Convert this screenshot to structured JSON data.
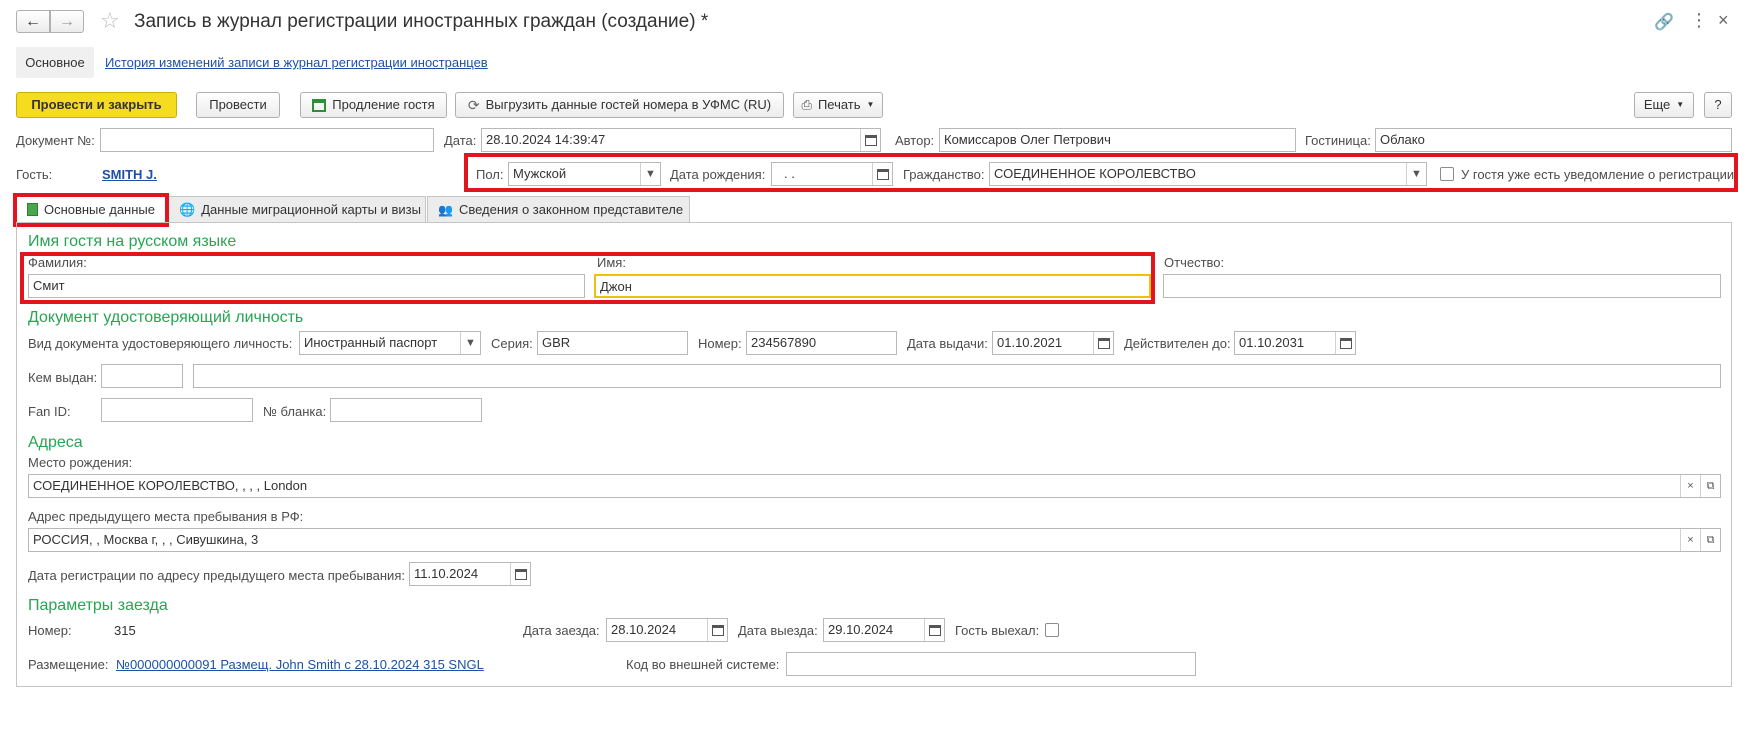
{
  "window": {
    "title": "Запись в журнал регистрации иностранных граждан (создание) *"
  },
  "nav_tabs": {
    "main": "Основное",
    "history": "История изменений записи в журнал регистрации иностранцев"
  },
  "toolbar": {
    "post_close": "Провести и закрыть",
    "post": "Провести",
    "extend_guest": "Продление гостя",
    "export_ufms": "Выгрузить данные гостей номера в УФМС (RU)",
    "print": "Печать",
    "more": "Еще",
    "help": "?"
  },
  "header": {
    "doc_no_label": "Документ №:",
    "doc_no_value": "",
    "date_label": "Дата:",
    "date_value": "28.10.2024 14:39:47",
    "author_label": "Автор:",
    "author_value": "Комиссаров Олег Петрович",
    "hotel_label": "Гостиница:",
    "hotel_value": "Облако",
    "guest_label": "Гость:",
    "guest_value": "SMITH J.",
    "sex_label": "Пол:",
    "sex_value": "Мужской",
    "birth_label": "Дата рождения:",
    "birth_value": ".  .",
    "citizenship_label": "Гражданство:",
    "citizenship_value": "СОЕДИНЕННОЕ КОРОЛЕВСТВО",
    "notice_label": "У гостя уже есть уведомление о регистрации",
    "notice_checked": false
  },
  "tabs": [
    {
      "label": "Основные данные",
      "active": true
    },
    {
      "label": "Данные миграционной карты и визы",
      "active": false
    },
    {
      "label": "Сведения о законном представителе",
      "active": false
    }
  ],
  "name_section": {
    "heading": "Имя гостя на русском языке",
    "surname_label": "Фамилия:",
    "surname_value": "Смит",
    "name_label": "Имя:",
    "name_value": "Джон",
    "patronymic_label": "Отчество:",
    "patronymic_value": ""
  },
  "id_doc": {
    "heading": "Документ удостоверяющий личность",
    "type_label": "Вид документа удостоверяющего личность:",
    "type_value": "Иностранный паспорт",
    "series_label": "Серия:",
    "series_value": "GBR",
    "number_label": "Номер:",
    "number_value": "234567890",
    "issue_label": "Дата выдачи:",
    "issue_value": "01.10.2021",
    "valid_label": "Действителен до:",
    "valid_value": "01.10.2031",
    "issued_by_label": "Кем выдан:",
    "issued_by_code": "",
    "issued_by_value": "",
    "fan_label": "Fan ID:",
    "fan_value": "",
    "blank_label": "№ бланка:",
    "blank_value": ""
  },
  "addresses": {
    "heading": "Адреса",
    "birth_place_label": "Место рождения:",
    "birth_place_value": "СОЕДИНЕННОЕ КОРОЛЕВСТВО, , , , London",
    "prev_addr_label": "Адрес предыдущего места пребывания в РФ:",
    "prev_addr_value": "РОССИЯ, , Москва г, , , Сивушкина, 3",
    "reg_date_label": "Дата регистрации по адресу предыдущего места пребывания:",
    "reg_date_value": "11.10.2024"
  },
  "stay": {
    "heading": "Параметры заезда",
    "room_label": "Номер:",
    "room_value": "315",
    "checkin_label": "Дата заезда:",
    "checkin_value": "28.10.2024",
    "checkout_label": "Дата выезда:",
    "checkout_value": "29.10.2024",
    "left_label": "Гость выехал:",
    "left_checked": false,
    "placement_label": "Размещение:",
    "placement_value": "№000000000091 Размещ. John Smith с 28.10.2024 315 SNGL",
    "ext_code_label": "Код во внешней системе:",
    "ext_code_value": ""
  },
  "colors": {
    "accent_yellow": "#f6dc1e",
    "section_green": "#27a552",
    "link_blue": "#1f4fa8",
    "highlight_red": "#e0151d"
  }
}
